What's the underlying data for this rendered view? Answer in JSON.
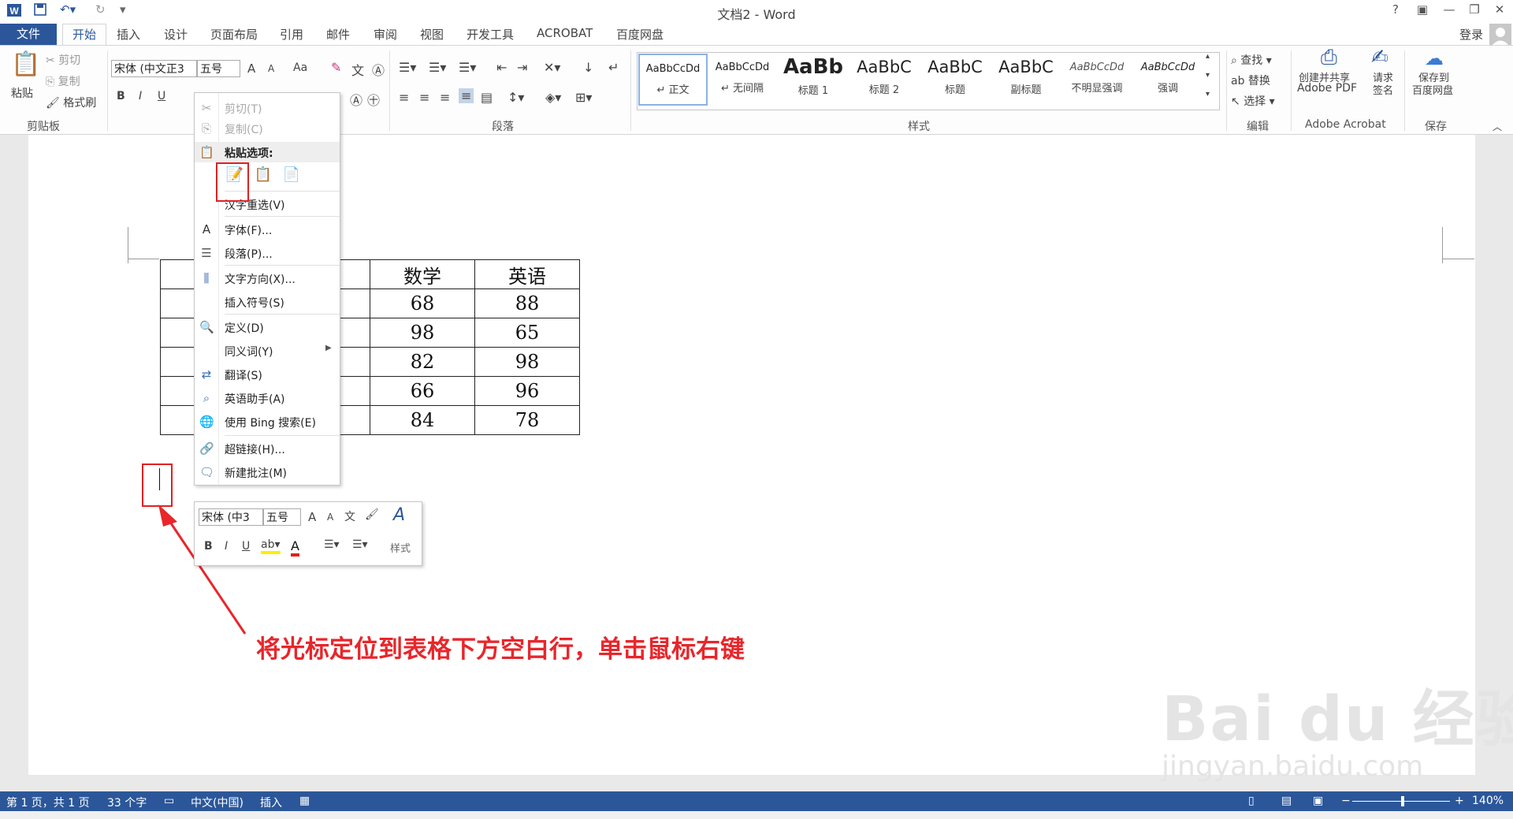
{
  "window": {
    "title": "文档2 - Word",
    "help": "?",
    "signin": "登录"
  },
  "qat": {
    "app_icon": "word-icon",
    "save_icon": "save-icon",
    "undo_icon": "undo-icon",
    "redo_icon": "redo-icon",
    "customize_icon": "customize-icon"
  },
  "tabs": {
    "file": "文件",
    "items": [
      "开始",
      "插入",
      "设计",
      "页面布局",
      "引用",
      "邮件",
      "审阅",
      "视图",
      "开发工具",
      "ACROBAT",
      "百度网盘"
    ]
  },
  "clipboard": {
    "paste": "粘贴",
    "cut": "剪切",
    "copy": "复制",
    "format_painter": "格式刷",
    "label": "剪贴板"
  },
  "font": {
    "name": "宋体 (中文正3",
    "size": "五号",
    "grow": "A",
    "shrink": "A",
    "case": "Aa",
    "bold": "B",
    "italic": "I",
    "underline": "U"
  },
  "paragraph": {
    "label": "段落"
  },
  "styles": {
    "label": "样式",
    "items": [
      {
        "sample": "AaBbCcDd",
        "name": "↵ 正文"
      },
      {
        "sample": "AaBbCcDd",
        "name": "↵ 无间隔"
      },
      {
        "sample": "AaBb",
        "name": "标题 1"
      },
      {
        "sample": "AaBbC",
        "name": "标题 2"
      },
      {
        "sample": "AaBbC",
        "name": "标题"
      },
      {
        "sample": "AaBbC",
        "name": "副标题"
      },
      {
        "sample": "AaBbCcDd",
        "name": "不明显强调"
      },
      {
        "sample": "AaBbCcDd",
        "name": "强调"
      }
    ]
  },
  "editing": {
    "find": "查找",
    "replace": "替换",
    "select": "选择",
    "label": "编辑"
  },
  "acrobat": {
    "create_line1": "创建并共享",
    "create_line2": "Adobe PDF",
    "sign_line1": "请求",
    "sign_line2": "签名",
    "label": "Adobe Acrobat"
  },
  "baidu": {
    "save_line1": "保存到",
    "save_line2": "百度网盘",
    "label": "保存"
  },
  "table": {
    "header": [
      "",
      "",
      "数学",
      "英语"
    ],
    "rows": [
      [
        "",
        "",
        "68",
        "88"
      ],
      [
        "",
        "",
        "98",
        "65"
      ],
      [
        "",
        "",
        "82",
        "98"
      ],
      [
        "",
        "",
        "66",
        "96"
      ],
      [
        "",
        "",
        "84",
        "78"
      ]
    ]
  },
  "context_menu": {
    "cut": "剪切(T)",
    "copy": "复制(C)",
    "paste_options": "粘贴选项:",
    "hanzi_reselect": "汉字重选(V)",
    "font": "字体(F)...",
    "paragraph": "段落(P)...",
    "text_direction": "文字方向(X)...",
    "insert_symbol": "插入符号(S)",
    "define": "定义(D)",
    "synonyms": "同义词(Y)",
    "translate": "翻译(S)",
    "english_assistant": "英语助手(A)",
    "bing_search": "使用 Bing 搜索(E)",
    "hyperlink": "超链接(H)...",
    "new_comment": "新建批注(M)"
  },
  "mini_toolbar": {
    "font": "宋体 (中3",
    "size": "五号",
    "styles": "样式",
    "bold": "B",
    "italic": "I",
    "underline": "U",
    "font_color_glyph": "A",
    "styles_glyph": "A"
  },
  "annotation": "将光标定位到表格下方空白行，单击鼠标右键",
  "watermark": {
    "logo": "Bai du 经验",
    "url": "jingyan.baidu.com"
  },
  "status": {
    "page": "第 1 页，共 1 页",
    "words": "33 个字",
    "language": "中文(中国)",
    "mode": "插入",
    "zoom": "140%",
    "minus": "−",
    "plus": "+"
  },
  "colors": {
    "accent": "#2b579a",
    "annotation_red": "#e8262b"
  }
}
